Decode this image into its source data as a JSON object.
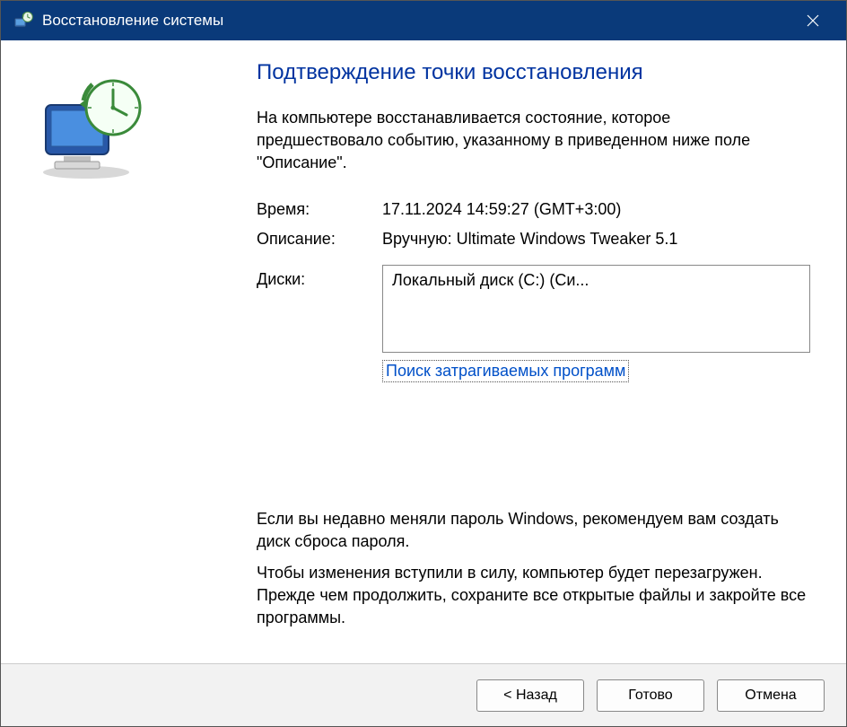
{
  "titlebar": {
    "title": "Восстановление системы"
  },
  "heading": "Подтверждение точки восстановления",
  "intro": "На компьютере восстанавливается состояние, которое предшествовало событию, указанному в приведенном ниже поле \"Описание\".",
  "fields": {
    "time_label": "Время:",
    "time_value": "17.11.2024 14:59:27 (GMT+3:00)",
    "desc_label": "Описание:",
    "desc_value": "Вручную: Ultimate Windows Tweaker 5.1",
    "disks_label": "Диски:",
    "disks_value": "Локальный диск (C:) (Си..."
  },
  "link": "Поиск затрагиваемых программ",
  "notes": {
    "p1": "Если вы недавно меняли пароль Windows, рекомендуем вам создать диск сброса пароля.",
    "p2": "Чтобы изменения вступили в силу, компьютер будет перезагружен. Прежде чем продолжить, сохраните все открытые файлы и закройте все программы."
  },
  "buttons": {
    "back": "< Назад",
    "finish": "Готово",
    "cancel": "Отмена"
  }
}
